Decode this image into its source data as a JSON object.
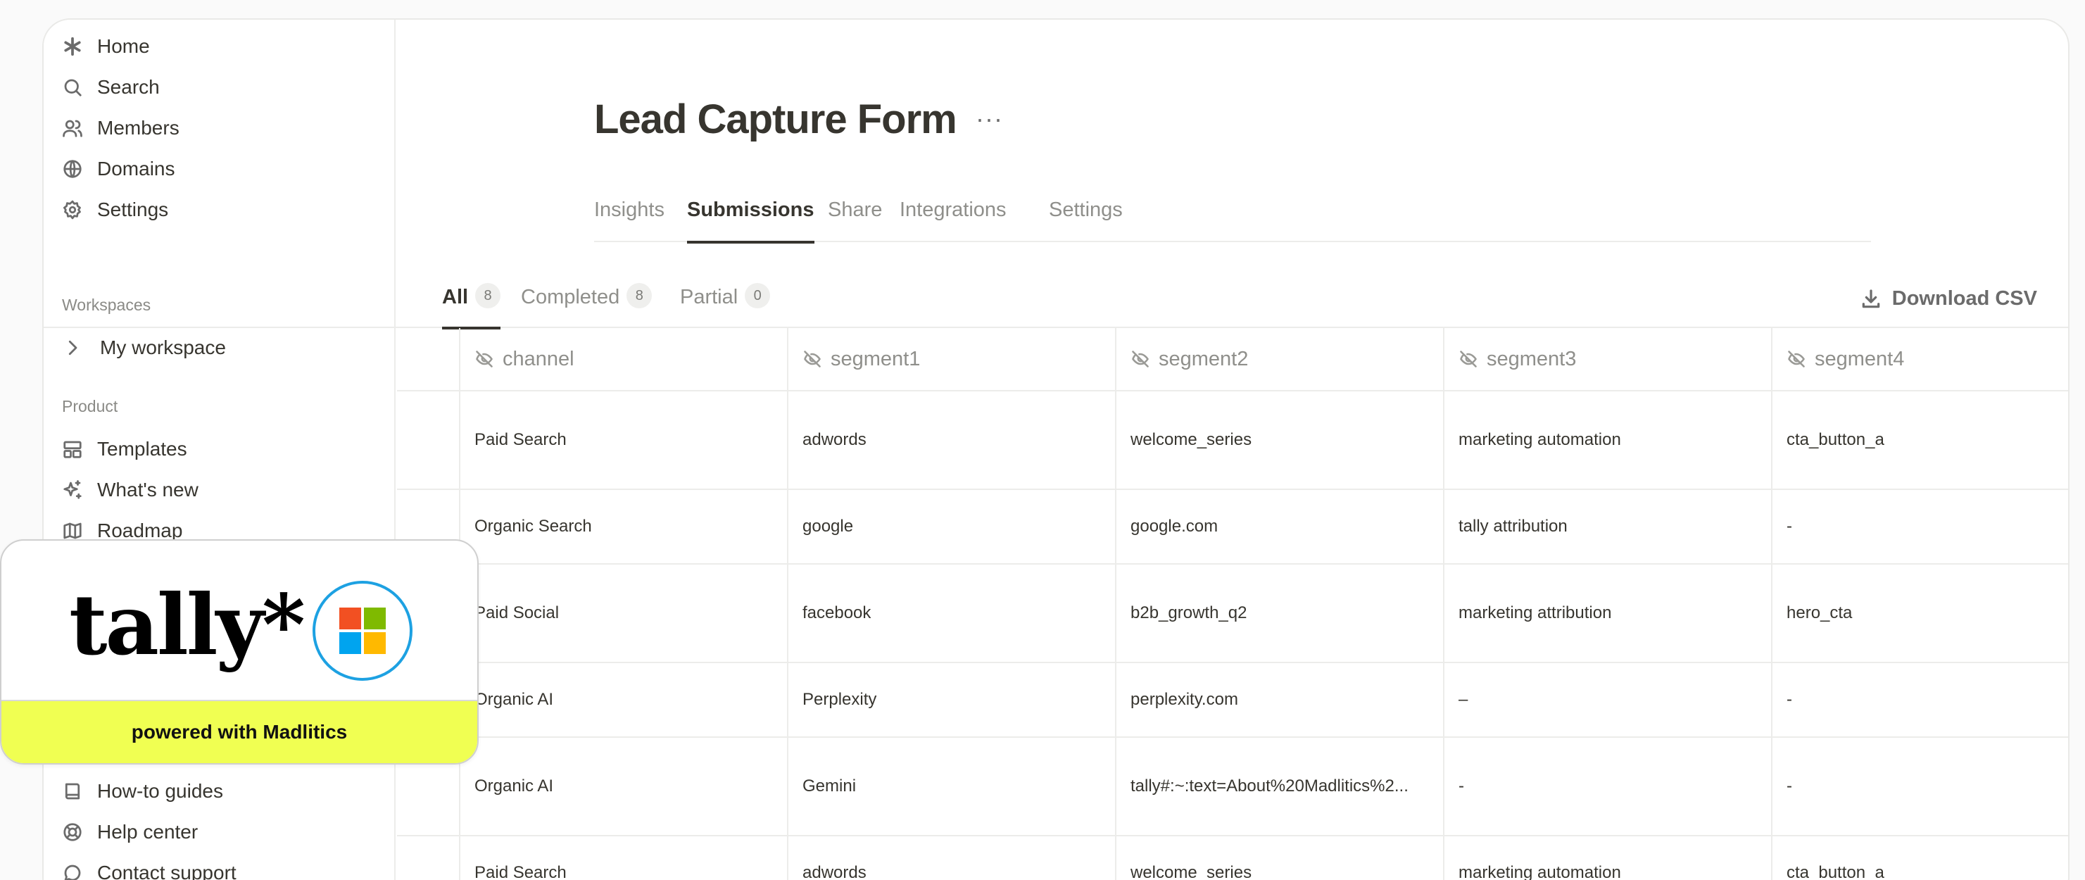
{
  "sidebar": {
    "nav": [
      {
        "label": "Home",
        "icon": "asterisk-icon"
      },
      {
        "label": "Search",
        "icon": "search-icon"
      },
      {
        "label": "Members",
        "icon": "users-icon"
      },
      {
        "label": "Domains",
        "icon": "globe-icon"
      },
      {
        "label": "Settings",
        "icon": "gear-icon"
      }
    ],
    "workspaces_label": "Workspaces",
    "workspace_item": "My workspace",
    "product_label": "Product",
    "product_items": [
      {
        "label": "Templates",
        "icon": "layout-icon"
      },
      {
        "label": "What's new",
        "icon": "sparkles-icon"
      },
      {
        "label": "Roadmap",
        "icon": "map-icon"
      }
    ],
    "help_items": [
      {
        "label": "How-to guides",
        "icon": "book-icon"
      },
      {
        "label": "Help center",
        "icon": "lifebuoy-icon"
      },
      {
        "label": "Contact support",
        "icon": "chat-icon"
      }
    ]
  },
  "form": {
    "title": "Lead Capture Form",
    "more": "···"
  },
  "tabs": [
    "Insights",
    "Submissions",
    "Share",
    "Integrations",
    "Settings"
  ],
  "active_tab": "Submissions",
  "subtabs": [
    {
      "label": "All",
      "count": "8"
    },
    {
      "label": "Completed",
      "count": "8"
    },
    {
      "label": "Partial",
      "count": "0"
    }
  ],
  "download_label": "Download CSV",
  "table": {
    "columns": [
      "channel",
      "segment1",
      "segment2",
      "segment3",
      "segment4"
    ],
    "rows": [
      [
        "Paid Search",
        "adwords",
        "welcome_series",
        "marketing automation",
        "cta_button_a"
      ],
      [
        "Organic Search",
        "google",
        "google.com",
        "tally attribution",
        "-"
      ],
      [
        "Paid Social",
        "facebook",
        "b2b_growth_q2",
        "marketing attribution",
        "hero_cta"
      ],
      [
        "Organic AI",
        "Perplexity",
        "perplexity.com",
        "–",
        "-"
      ],
      [
        "Organic AI",
        "Gemini",
        "tally#:~:text=About%20Madlitics%2...",
        "-",
        "-"
      ],
      [
        "Paid Search",
        "adwords",
        "welcome_series",
        "marketing automation",
        "cta_button_a"
      ]
    ]
  },
  "promo": {
    "logo_text": "tally*",
    "footer": "powered with Madlitics",
    "colors": {
      "footer_bg": "#f0ff52",
      "ring": "#1da1e2",
      "ms_red": "#f25022",
      "ms_green": "#7fba00",
      "ms_blue": "#00a4ef",
      "ms_yellow": "#ffb900"
    }
  }
}
